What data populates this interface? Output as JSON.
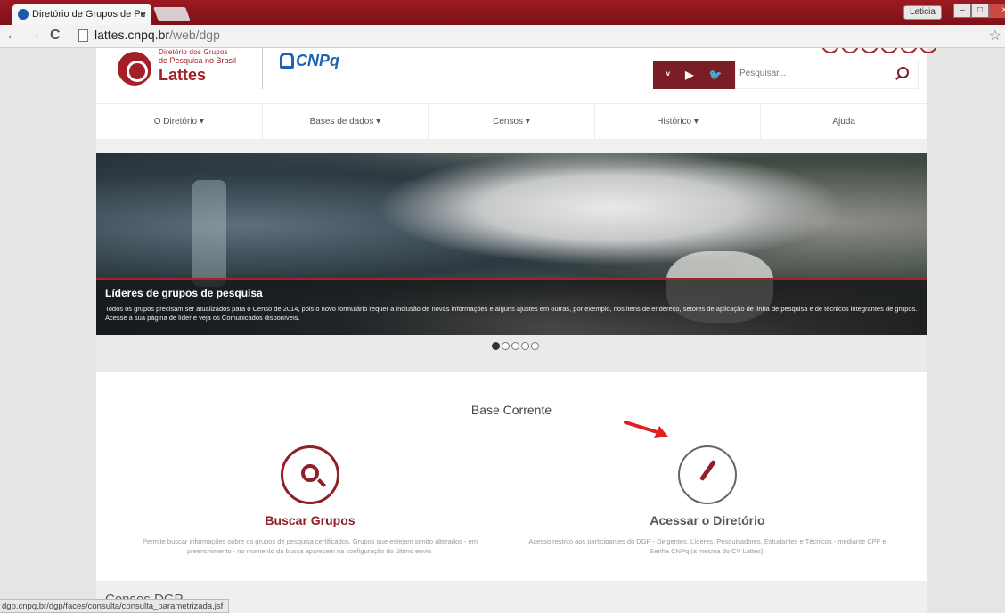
{
  "browser": {
    "tab_title": "Diretório de Grupos de Pe",
    "tab_close": "×",
    "user": "Leticia",
    "url_host": "lattes.cnpq.br",
    "url_path": "/web/dgp",
    "nav_back": "←",
    "nav_forward": "→",
    "nav_reload": "C",
    "bookmark_star": "☆",
    "win_minimize": "–",
    "win_maximize": "□",
    "win_close": "×"
  },
  "header": {
    "logo_line1": "Diretório dos Grupos",
    "logo_line2": "de Pesquisa no Brasil",
    "logo_line3": "Lattes",
    "cnpq": "CNPq",
    "social": {
      "rss": "ᵛ",
      "youtube": "▶",
      "twitter": "🐦"
    },
    "search_placeholder": "Pesquisar..."
  },
  "nav": {
    "items": [
      "O Diretório ▾",
      "Bases de dados ▾",
      "Censos ▾",
      "Histórico ▾",
      "Ajuda"
    ]
  },
  "banner": {
    "title": "Líderes de grupos de pesquisa",
    "text": "Todos os grupos precisam ser atualizados para o Censo de 2014, pois o novo formulário requer a inclusão de novas informações e alguns ajustes em outras, por exemplo, nos itens de endereço, setores de aplicação de linha de pesquisa e de técnicos integrantes de grupos. Acesse a sua página de líder e veja os Comunicados disponíveis.",
    "slides_total": 5,
    "slide_active": 1
  },
  "base_corrente": {
    "title": "Base Corrente",
    "buscar_title": "Buscar Grupos",
    "buscar_desc": "Permite buscar informações sobre os grupos de pesquisa certificados. Grupos que estejam sendo alterados - em preenchimento - no momento da busca aparecem na configuração do último envio.",
    "acessar_title": "Acessar o Diretório",
    "acessar_desc": "Acesso restrito aos participantes do DGP - Dirigentes, Líderes, Pesquisadores, Estudantes e Técnicos - mediante CPF e Senha CNPq (a mesma do CV Lattes)."
  },
  "censos": {
    "title": "Censos DGP"
  },
  "status_bar": "dgp.cnpq.br/dgp/faces/consulta/consulta_parametrizada.jsf",
  "colors": {
    "accent": "#8e2127",
    "arrow": "#e02020"
  }
}
